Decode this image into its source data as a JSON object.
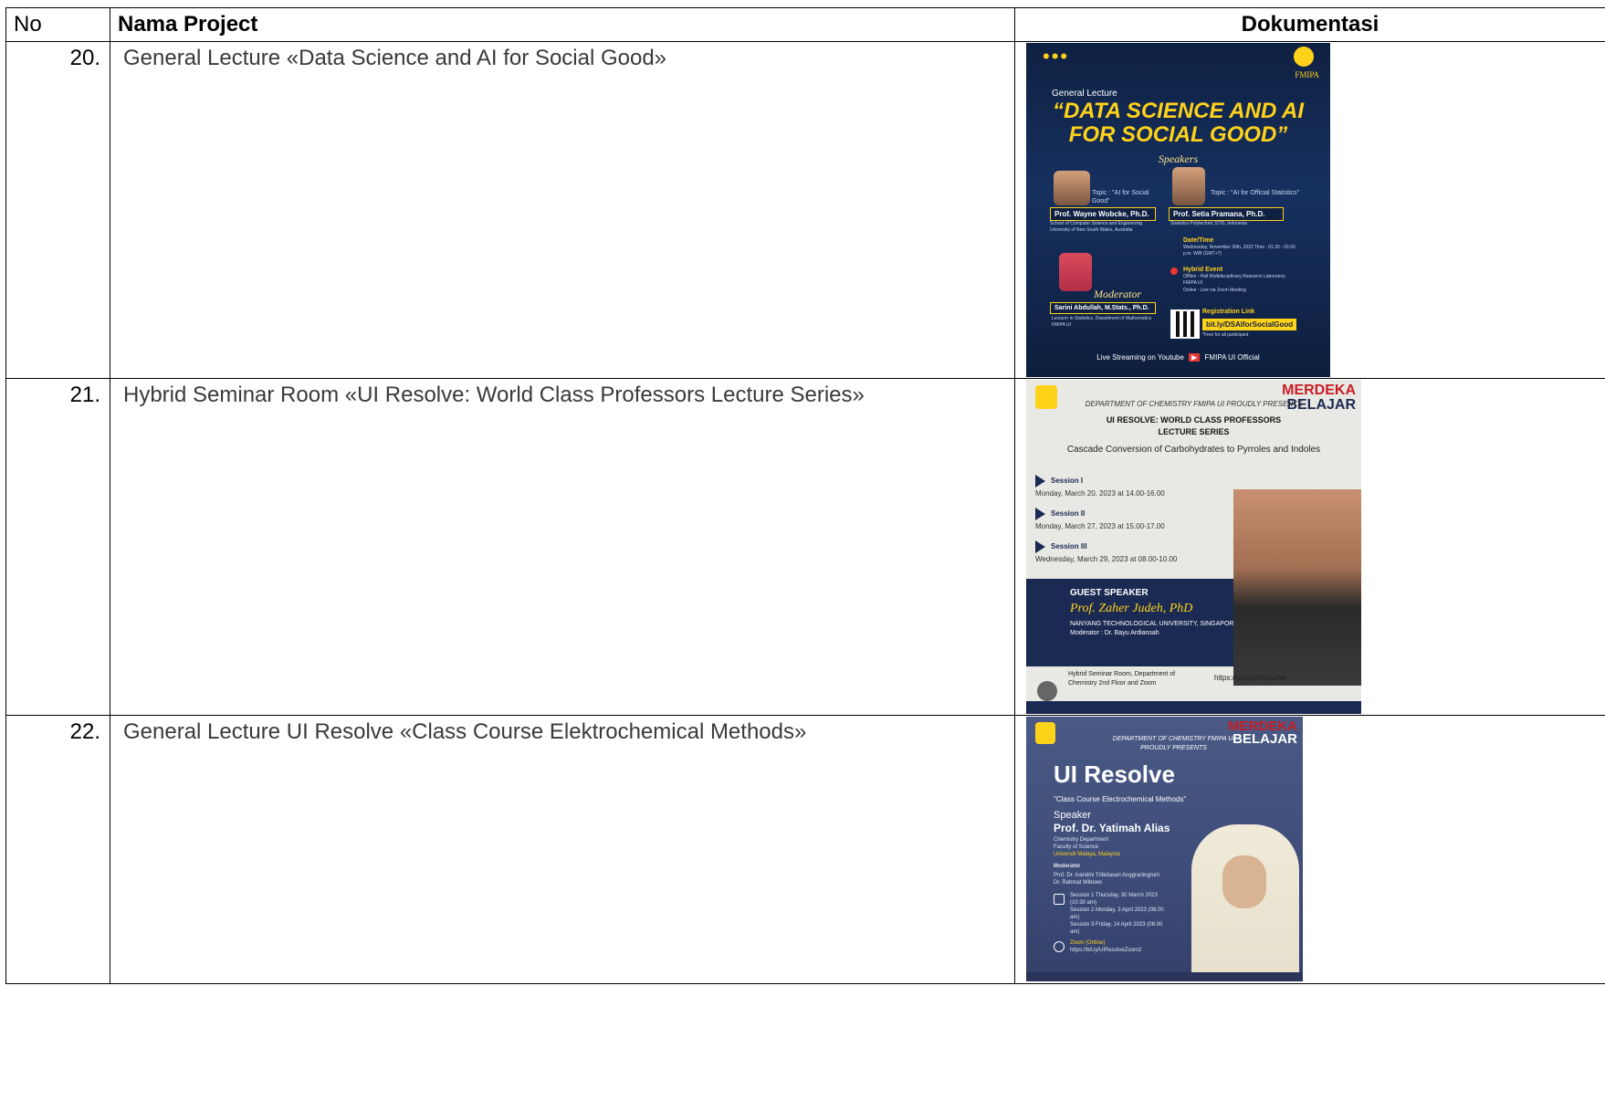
{
  "table": {
    "headers": {
      "no": "No",
      "name": "Nama Project",
      "documentation": "Dokumentasi"
    },
    "rows": [
      {
        "no": "20.",
        "title": "General Lecture «Data Science and AI for Social Good»",
        "poster": {
          "label": "General Lecture",
          "headline": "“DATA SCIENCE AND AI FOR SOCIAL GOOD”",
          "speakers_label": "Speakers",
          "brand": "FMIPA",
          "speaker1_topic": "Topic : \"AI for Social Good\"",
          "speaker1_name": "Prof. Wayne Wobcke, Ph.D.",
          "speaker1_affil": "School of Computer Science and Engineering University of New South Wales, Australia",
          "speaker2_topic": "Topic : \"AI for Official Statistics\"",
          "speaker2_name": "Prof. Setia Pramana, Ph.D.",
          "speaker2_affil": "Statistics Polytechnic STIS, Indonesia",
          "datetime_label": "Date/Time",
          "datetime": "Wednesday, November 30th, 2022 Time : 01.30 - 03.00 p.m. WIB (GMT+7)",
          "hybrid_label": "Hybrid Event",
          "hybrid_offline": "Offline : Hall Multidisciplinary Research Laboratory FMIPA UI",
          "hybrid_online": "Online : Live via Zoom Meeting",
          "moderator_label": "Moderator",
          "moderator_name": "Sarini Abdullah, M.Stats., Ph.D.",
          "moderator_affil": "Lecturer in Statistics, Department of Mathematics FMIPA UI",
          "registration_label": "Registration Link",
          "registration_link": "bit.ly/DSAIforSocialGood",
          "registration_note": "*Free for all participant",
          "streaming": "Live Streaming on Youtube",
          "channel": "FMIPA UI Official"
        }
      },
      {
        "no": "21.",
        "title": "Hybrid Seminar Room «UI Resolve: World Class Professors Lecture Series»",
        "poster": {
          "dept": "DEPARTMENT OF CHEMISTRY FMIPA UI PROUDLY PRESENTS",
          "brand_top": "MERDEKA",
          "brand_bottom": "BELAJAR",
          "title": "UI RESOLVE: WORLD CLASS PROFESSORS LECTURE SERIES",
          "subtitle": "Cascade Conversion of Carbohydrates to Pyrroles and Indoles",
          "sessions": [
            {
              "name": "Session I",
              "date": "Monday, March 20, 2023 at 14.00-16.00"
            },
            {
              "name": "Session II",
              "date": "Monday, March 27, 2023 at 15.00-17.00"
            },
            {
              "name": "Session III",
              "date": "Wednesday, March 29, 2023 at 08.00-10.00"
            }
          ],
          "guest_label": "GUEST SPEAKER",
          "guest_name": "Prof. Zaher Judeh, PhD",
          "guest_affil": "NANYANG TECHNOLOGICAL UNIVERSITY, SINGAPORE",
          "moderator": "Moderator : Dr. Bayu Ardiansah",
          "location": "Hybrid Seminar Room, Department of Chemistry 2nd Floor and Zoom",
          "link": "https://bit.ly/UIResolve"
        }
      },
      {
        "no": "22.",
        "title": "General Lecture UI Resolve «Class Course Elektrochemical Methods»",
        "poster": {
          "dept": "DEPARTMENT OF CHEMISTRY FMIPA UI PROUDLY PRESENTS",
          "brand_top": "MERDEKA",
          "brand_bottom": "BELAJAR",
          "headline": "UI Resolve",
          "subtitle": "\"Class Course Electrochemical Methods\"",
          "speaker_label": "Speaker",
          "speaker_name": "Prof. Dr. Yatimah Alias",
          "speaker_affil1": "Chemistry Department",
          "speaker_affil2": "Faculty of Science",
          "speaker_affil3": "Universiti Malaya, Malaysia",
          "moderator_label": "Moderator",
          "moderator1": "Prof. Dr. Ivandini Tribidasari Anggraningrum",
          "moderator2": "Dr. Rahmat Wibowo",
          "session1": "Session 1 Thursday, 30 March 2023 (10.30 am)",
          "session2": "Session 2 Monday, 3 April 2023 (08.00 am)",
          "session3": "Session 3 Friday, 14 April 2023 (08.00 am)",
          "zoom_label": "Zoom (Online)",
          "zoom_link": "https://bit.ly/UIResolveZoom2"
        }
      }
    ]
  }
}
